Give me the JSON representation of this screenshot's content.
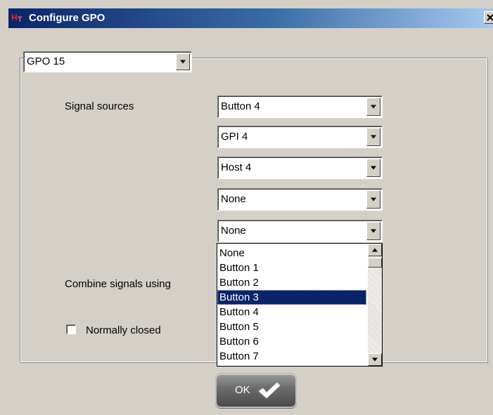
{
  "window": {
    "title": "Configure GPO",
    "title_bar_color": "#0a246a",
    "logo_icon": "ht-logo-icon",
    "close_icon": "close-x-icon"
  },
  "gpo_select": {
    "value": "GPO 15"
  },
  "signal_sources": {
    "label": "Signal sources",
    "sources": [
      "Button 4",
      "GPI 4",
      "Host 4",
      "None",
      "None"
    ]
  },
  "dropdown": {
    "items": [
      "None",
      "Button 1",
      "Button 2",
      "Button 3",
      "Button 4",
      "Button 5",
      "Button 6",
      "Button 7"
    ],
    "highlighted": "Button 3",
    "highlight_color": "#0a246a"
  },
  "combine": {
    "label": "Combine signals using"
  },
  "normally_closed": {
    "label": "Normally closed",
    "checked": false
  },
  "ok_button": {
    "label": "OK",
    "icon": "checkmark-icon"
  }
}
